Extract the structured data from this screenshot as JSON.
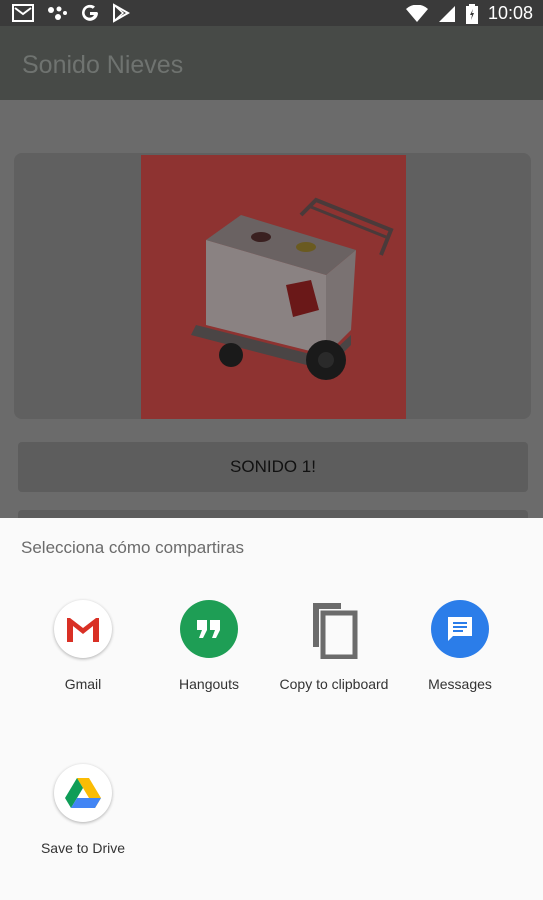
{
  "status_bar": {
    "time": "10:08",
    "left_icons": [
      "gmail-icon",
      "assistant-icon",
      "google-icon",
      "play-store-icon"
    ],
    "right_icons": [
      "wifi-icon",
      "signal-icon",
      "battery-icon"
    ]
  },
  "app_bar": {
    "title": "Sonido Nieves"
  },
  "main": {
    "button_label": "SONIDO 1!"
  },
  "share_sheet": {
    "title": "Selecciona cómo compartiras",
    "targets": [
      {
        "label": "Gmail",
        "icon": "gmail-icon"
      },
      {
        "label": "Hangouts",
        "icon": "hangouts-icon"
      },
      {
        "label": "Copy to clipboard",
        "icon": "clipboard-icon"
      },
      {
        "label": "Messages",
        "icon": "messages-icon"
      },
      {
        "label": "Save to Drive",
        "icon": "drive-icon"
      }
    ]
  },
  "colors": {
    "hangouts": "#1e9e55",
    "messages": "#2b7de9",
    "gmail_red": "#d93025"
  }
}
